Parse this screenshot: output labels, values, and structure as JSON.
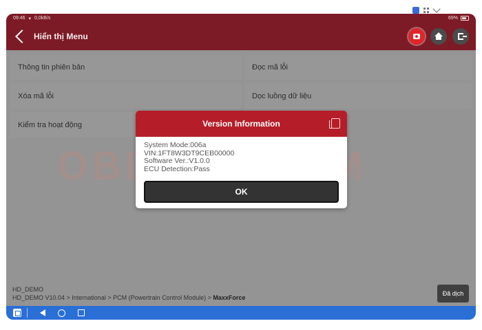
{
  "status_bar": {
    "time": "09:46",
    "left_extra": "0,0kB/s",
    "battery": "69%"
  },
  "header": {
    "title": "Hiển thị Menu"
  },
  "menu": {
    "items": [
      {
        "label": "Thông tin phiên bản"
      },
      {
        "label": "Đọc mã lỗi"
      },
      {
        "label": "Xóa mã lỗi"
      },
      {
        "label": "Dọc luồng dữ liệu"
      },
      {
        "label": "Kiểm tra hoạt động"
      }
    ]
  },
  "watermark": {
    "text": "OBDVIETNAM"
  },
  "dialog": {
    "title": "Version Information",
    "lines": [
      "System Mode:006a",
      "VIN:1FT8W3DT9CEB00000",
      "Software Ver.:V1.0.0",
      "ECU Detection:Pass"
    ],
    "ok_label": "OK"
  },
  "footer": {
    "device": "HD_DEMO",
    "path_prefix": "HD_DEMO V10.04 > International > PCM (Powertrain Control Module) > ",
    "path_last": "MaxxForce",
    "translate_label": "Đã dịch"
  },
  "icons": {
    "back": "chevron-left-icon",
    "camera": "camera-icon",
    "home": "home-icon",
    "exit": "exit-icon",
    "copy": "copy-icon"
  }
}
